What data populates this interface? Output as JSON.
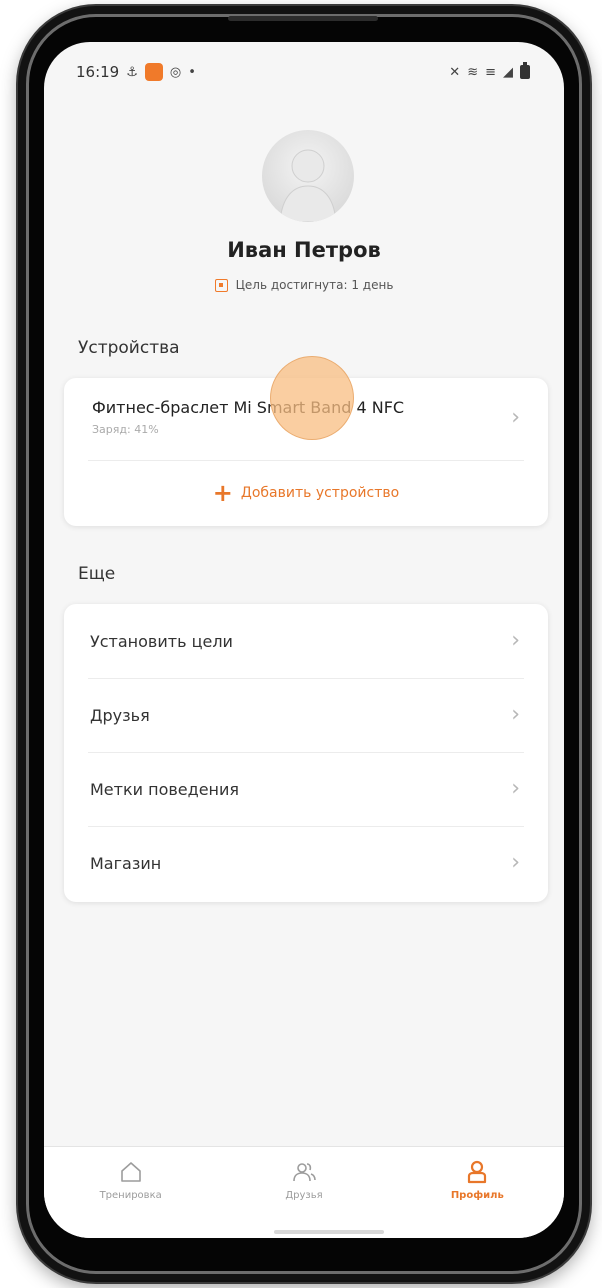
{
  "status_bar": {
    "time": "16:19",
    "dot": "•"
  },
  "profile": {
    "name": "Иван Петров",
    "goal_text": "Цель достигнута: 1 день"
  },
  "devices": {
    "section_title": "Устройства",
    "items": [
      {
        "name": "Фитнес-браслет Mi Smart Band 4 NFC",
        "battery": "Заряд: 41%"
      }
    ],
    "add_label": "Добавить устройство"
  },
  "more": {
    "section_title": "Еще",
    "items": [
      {
        "label": "Установить цели"
      },
      {
        "label": "Друзья"
      },
      {
        "label": "Метки поведения"
      },
      {
        "label": "Магазин"
      }
    ]
  },
  "nav": {
    "items": [
      {
        "label": "Тренировка",
        "icon": "home-icon"
      },
      {
        "label": "Друзья",
        "icon": "friends-icon"
      },
      {
        "label": "Профиль",
        "icon": "profile-icon",
        "active": true
      }
    ]
  },
  "colors": {
    "accent": "#e8772a",
    "notification": "#f07a2a",
    "background": "#f6f6f6"
  }
}
